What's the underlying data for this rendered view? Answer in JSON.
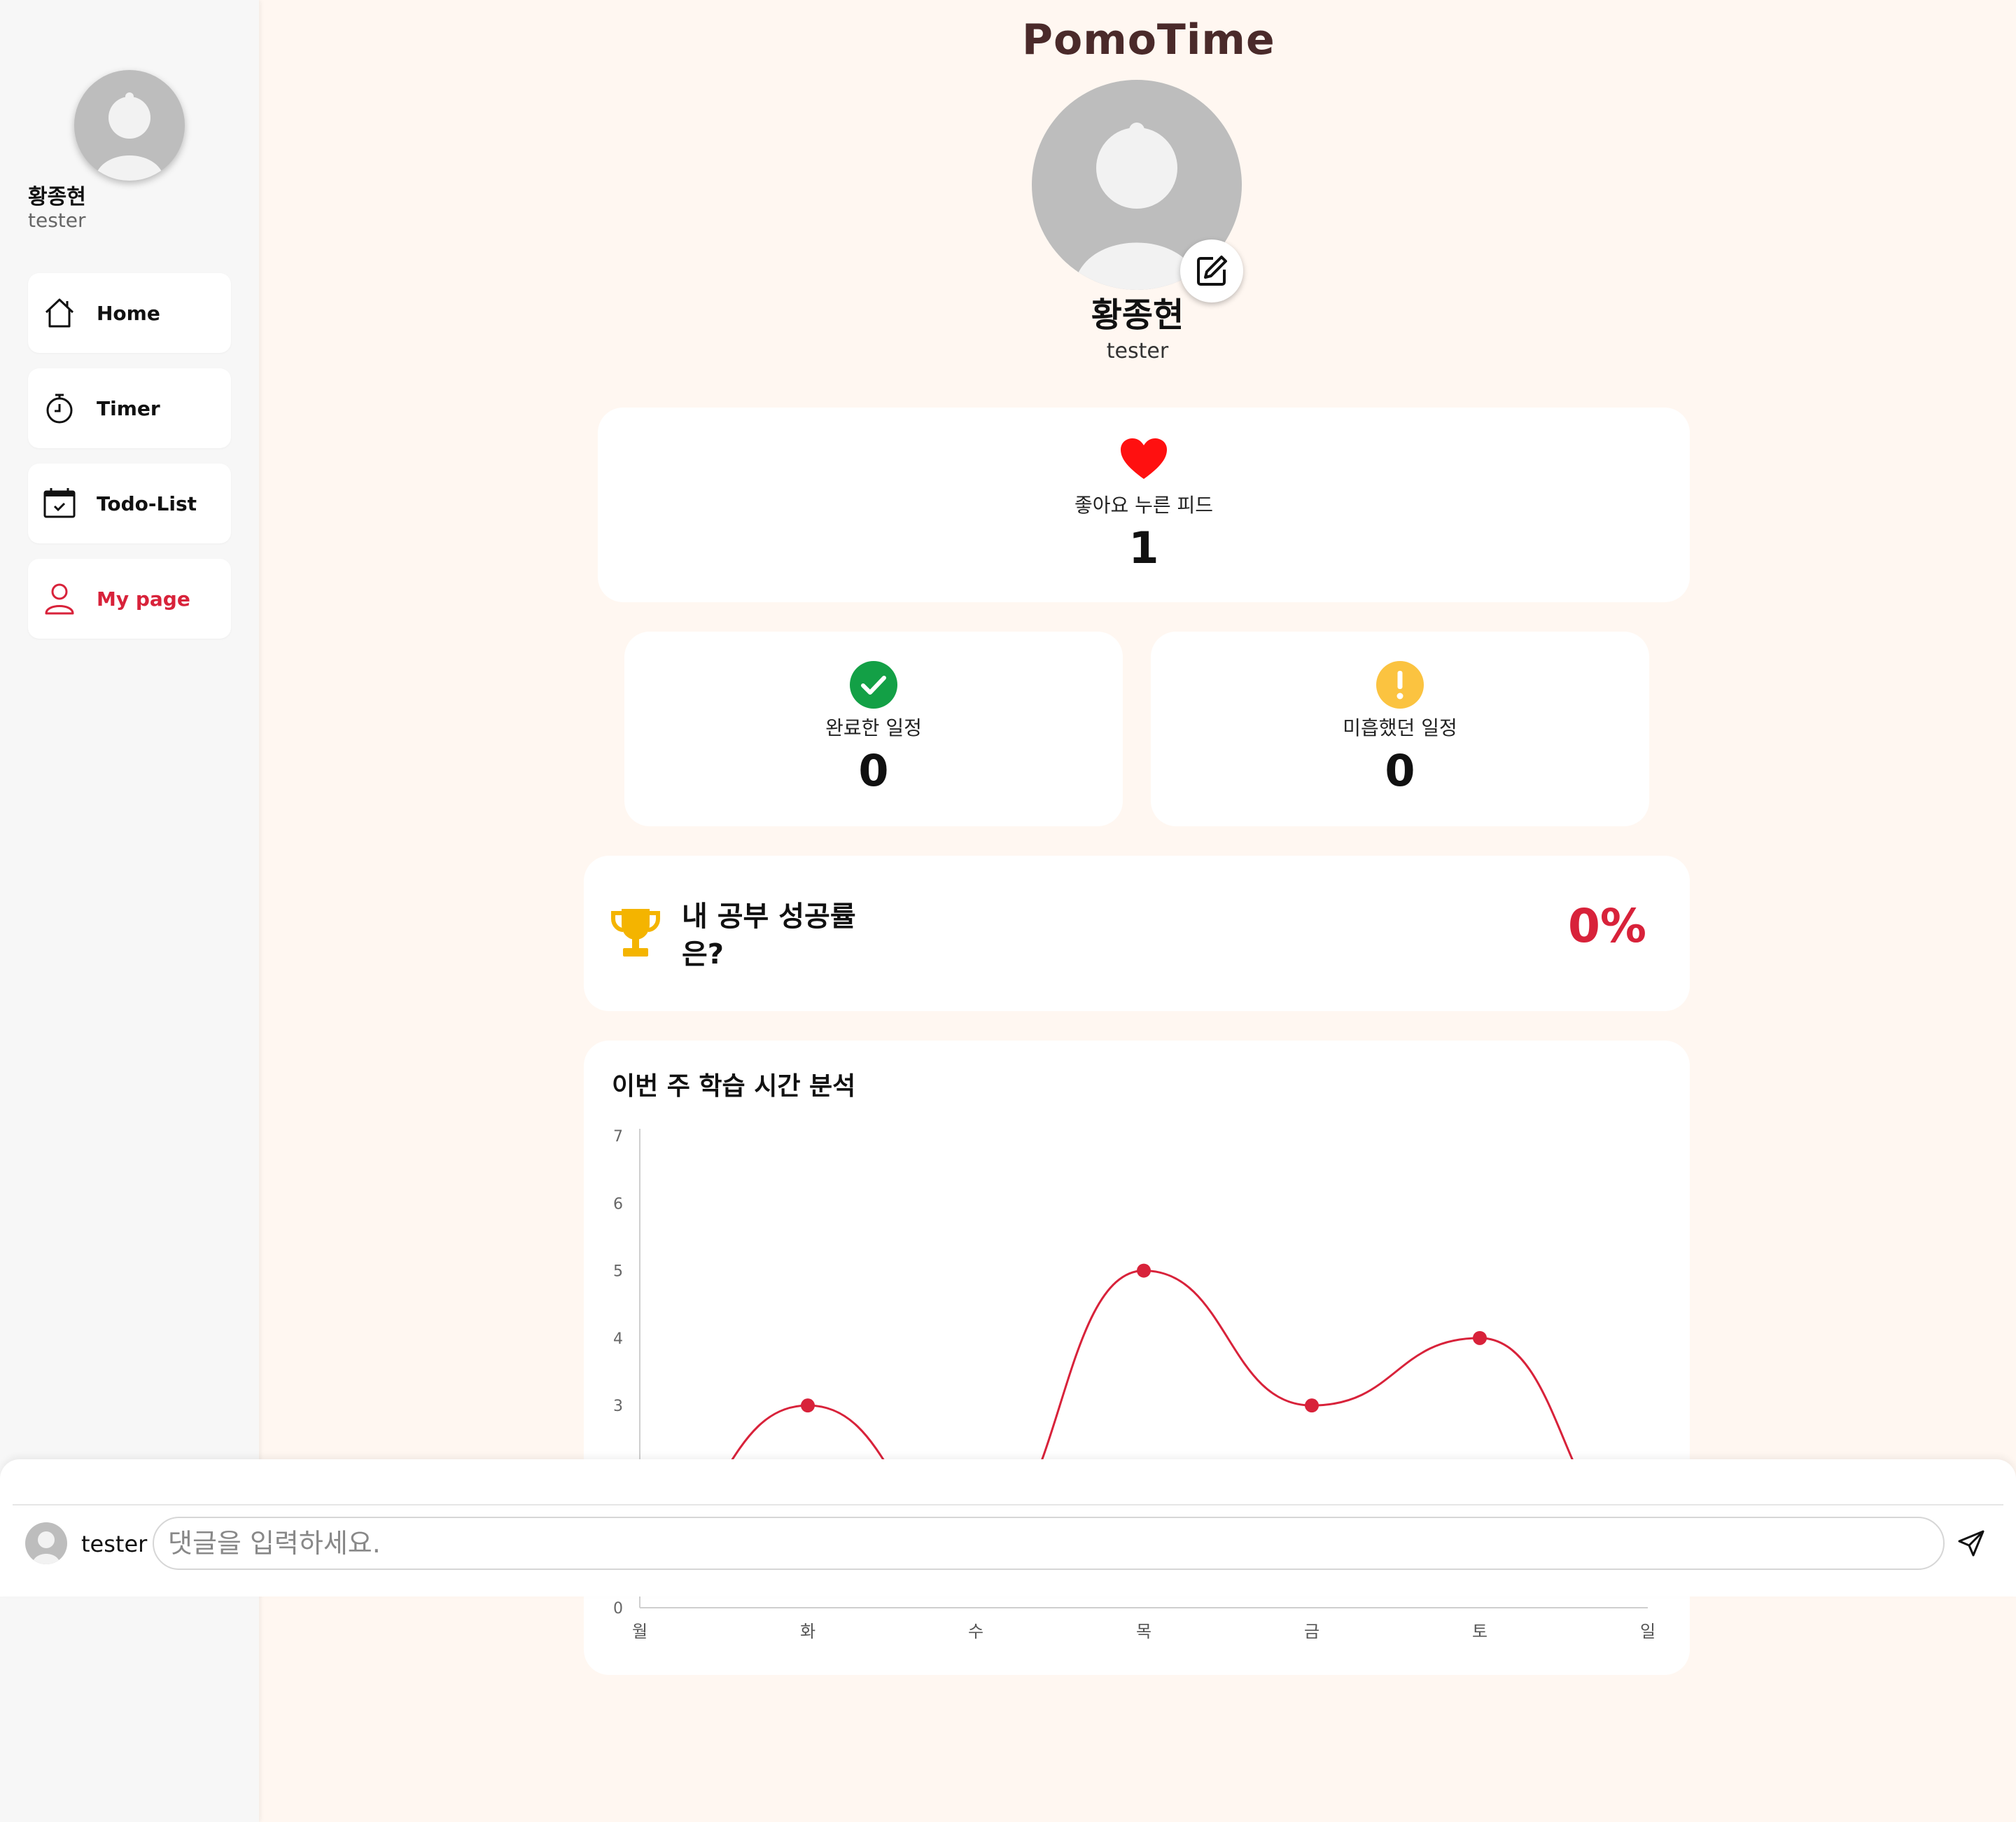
{
  "app": {
    "logo": "PomoTime"
  },
  "sidebar": {
    "user_name": "황종현",
    "user_id": "tester",
    "items": [
      {
        "label": "Home",
        "icon": "home-icon",
        "active": false
      },
      {
        "label": "Timer",
        "icon": "timer-icon",
        "active": false
      },
      {
        "label": "Todo-List",
        "icon": "calendar-check-icon",
        "active": false
      },
      {
        "label": "My page",
        "icon": "user-icon",
        "active": true
      }
    ]
  },
  "profile": {
    "name": "황종현",
    "id": "tester",
    "edit_icon": "edit-icon"
  },
  "stats": {
    "liked": {
      "label": "좋아요 누른 피드",
      "value": "1",
      "icon": "heart-icon",
      "color": "#ff1010"
    },
    "completed": {
      "label": "완료한 일정",
      "value": "0",
      "icon": "check-circle-icon",
      "color": "#13a046"
    },
    "missed": {
      "label": "미흡했던 일정",
      "value": "0",
      "icon": "exclamation-circle-icon",
      "color": "#fbc340"
    }
  },
  "success": {
    "question": "내 공부 성공률은?",
    "value": "0%",
    "icon": "trophy-icon",
    "accent": "#d8223a"
  },
  "chart_data": {
    "type": "line",
    "title": "이번 주 학습 시간 분석",
    "categories": [
      "월",
      "화",
      "수",
      "목",
      "금",
      "토",
      "일"
    ],
    "values": [
      1,
      3,
      1,
      5,
      3,
      4,
      1
    ],
    "y_ticks": [
      "0",
      "3",
      "4",
      "5",
      "6",
      "7"
    ],
    "ylim": [
      0,
      7
    ],
    "line_color": "#d8223a",
    "grid": false
  },
  "comment": {
    "user": "tester",
    "placeholder": "댓글을 입력하세요.",
    "send_icon": "send-icon"
  }
}
